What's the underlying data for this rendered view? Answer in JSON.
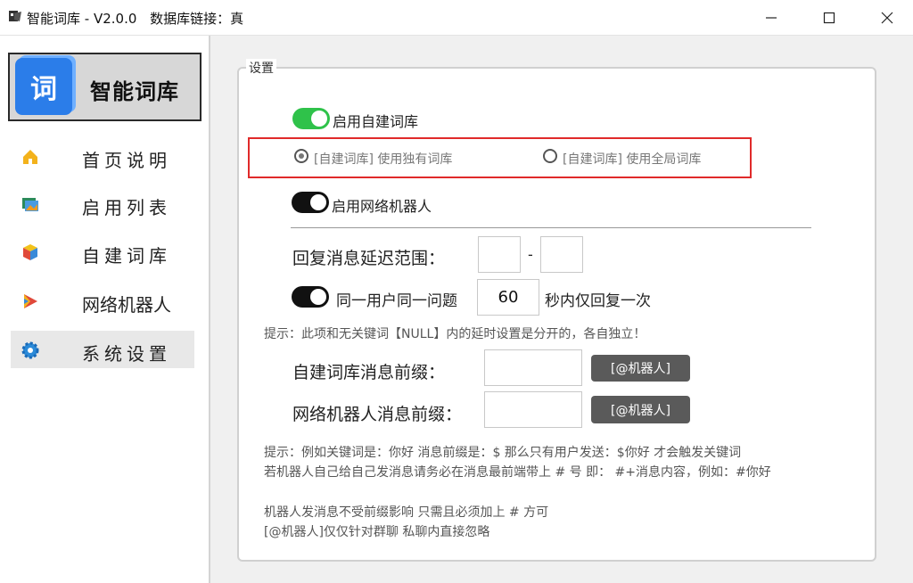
{
  "window": {
    "title": "智能词库 - V2.0.0",
    "db_status": "数据库链接：真",
    "minimize_glyph": "—",
    "maximize_glyph": "☐",
    "close_glyph": "✕"
  },
  "brand": {
    "logo_char": "词",
    "name": "智能词库"
  },
  "sidebar": {
    "items": [
      {
        "label": "首页说明",
        "icon": "home-icon"
      },
      {
        "label": "启用列表",
        "icon": "image-list-icon"
      },
      {
        "label": "自建词库",
        "icon": "cube-icon"
      },
      {
        "label": "网络机器人",
        "icon": "play-flag-icon"
      },
      {
        "label": "系统设置",
        "icon": "gear-icon",
        "active": true
      }
    ]
  },
  "settings": {
    "legend": "设置",
    "enable_custom_lib": {
      "label": "启用自建词库",
      "on": true
    },
    "radio_unique": {
      "label": "[自建词库] 使用独有词库",
      "checked": true
    },
    "radio_global": {
      "label": "[自建词库] 使用全局词库",
      "checked": false
    },
    "enable_network_robot": {
      "label": "启用网络机器人",
      "on": false
    },
    "delay_label": "回复消息延迟范围：",
    "delay_min": "",
    "delay_sep": "-",
    "delay_max": "",
    "same_user": {
      "label": "同一用户同一问题",
      "on": false
    },
    "same_user_seconds": "60",
    "same_user_suffix": "秒内仅回复一次",
    "hint_delay": "提示：此项和无关键词【NULL】内的延时设置是分开的，各自独立！",
    "custom_prefix_label": "自建词库消息前缀：",
    "custom_prefix_value": "",
    "custom_prefix_btn": "[@机器人]",
    "network_prefix_label": "网络机器人消息前缀：",
    "network_prefix_value": "",
    "network_prefix_btn": "[@机器人]",
    "hint_lines": [
      "提示：例如关键词是：你好 消息前缀是：$ 那么只有用户发送：$你好 才会触发关键词",
      "若机器人自己给自己发消息请务必在消息最前端带上 # 号 即： #+消息内容，例如：#你好",
      "机器人发消息不受前缀影响 只需且必须加上 # 方可",
      "[@机器人]仅仅针对群聊 私聊内直接忽略"
    ]
  },
  "colors": {
    "toggle_on": "#2fc24a",
    "toggle_off": "#111111",
    "highlight_border": "#e02a2a",
    "brand_blue": "#2b7de9",
    "button_dark": "#5a5a5a"
  }
}
